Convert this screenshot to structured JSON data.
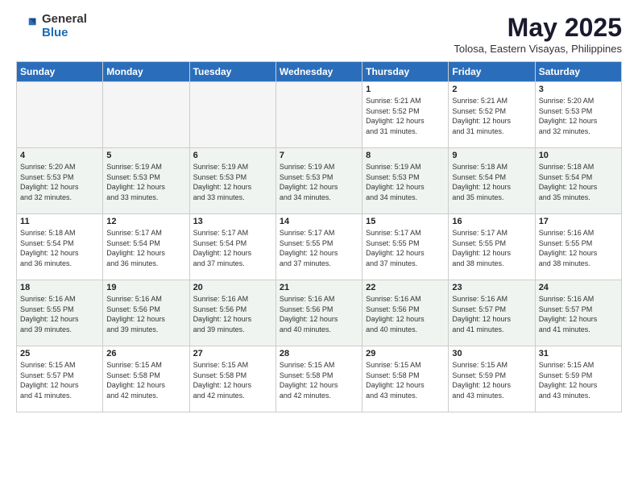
{
  "logo": {
    "general": "General",
    "blue": "Blue"
  },
  "title": "May 2025",
  "subtitle": "Tolosa, Eastern Visayas, Philippines",
  "headers": [
    "Sunday",
    "Monday",
    "Tuesday",
    "Wednesday",
    "Thursday",
    "Friday",
    "Saturday"
  ],
  "weeks": [
    {
      "shaded": false,
      "days": [
        {
          "num": "",
          "info": "",
          "empty": true
        },
        {
          "num": "",
          "info": "",
          "empty": true
        },
        {
          "num": "",
          "info": "",
          "empty": true
        },
        {
          "num": "",
          "info": "",
          "empty": true
        },
        {
          "num": "1",
          "info": "Sunrise: 5:21 AM\nSunset: 5:52 PM\nDaylight: 12 hours\nand 31 minutes."
        },
        {
          "num": "2",
          "info": "Sunrise: 5:21 AM\nSunset: 5:52 PM\nDaylight: 12 hours\nand 31 minutes."
        },
        {
          "num": "3",
          "info": "Sunrise: 5:20 AM\nSunset: 5:53 PM\nDaylight: 12 hours\nand 32 minutes."
        }
      ]
    },
    {
      "shaded": true,
      "days": [
        {
          "num": "4",
          "info": "Sunrise: 5:20 AM\nSunset: 5:53 PM\nDaylight: 12 hours\nand 32 minutes."
        },
        {
          "num": "5",
          "info": "Sunrise: 5:19 AM\nSunset: 5:53 PM\nDaylight: 12 hours\nand 33 minutes."
        },
        {
          "num": "6",
          "info": "Sunrise: 5:19 AM\nSunset: 5:53 PM\nDaylight: 12 hours\nand 33 minutes."
        },
        {
          "num": "7",
          "info": "Sunrise: 5:19 AM\nSunset: 5:53 PM\nDaylight: 12 hours\nand 34 minutes."
        },
        {
          "num": "8",
          "info": "Sunrise: 5:19 AM\nSunset: 5:53 PM\nDaylight: 12 hours\nand 34 minutes."
        },
        {
          "num": "9",
          "info": "Sunrise: 5:18 AM\nSunset: 5:54 PM\nDaylight: 12 hours\nand 35 minutes."
        },
        {
          "num": "10",
          "info": "Sunrise: 5:18 AM\nSunset: 5:54 PM\nDaylight: 12 hours\nand 35 minutes."
        }
      ]
    },
    {
      "shaded": false,
      "days": [
        {
          "num": "11",
          "info": "Sunrise: 5:18 AM\nSunset: 5:54 PM\nDaylight: 12 hours\nand 36 minutes."
        },
        {
          "num": "12",
          "info": "Sunrise: 5:17 AM\nSunset: 5:54 PM\nDaylight: 12 hours\nand 36 minutes."
        },
        {
          "num": "13",
          "info": "Sunrise: 5:17 AM\nSunset: 5:54 PM\nDaylight: 12 hours\nand 37 minutes."
        },
        {
          "num": "14",
          "info": "Sunrise: 5:17 AM\nSunset: 5:55 PM\nDaylight: 12 hours\nand 37 minutes."
        },
        {
          "num": "15",
          "info": "Sunrise: 5:17 AM\nSunset: 5:55 PM\nDaylight: 12 hours\nand 37 minutes."
        },
        {
          "num": "16",
          "info": "Sunrise: 5:17 AM\nSunset: 5:55 PM\nDaylight: 12 hours\nand 38 minutes."
        },
        {
          "num": "17",
          "info": "Sunrise: 5:16 AM\nSunset: 5:55 PM\nDaylight: 12 hours\nand 38 minutes."
        }
      ]
    },
    {
      "shaded": true,
      "days": [
        {
          "num": "18",
          "info": "Sunrise: 5:16 AM\nSunset: 5:55 PM\nDaylight: 12 hours\nand 39 minutes."
        },
        {
          "num": "19",
          "info": "Sunrise: 5:16 AM\nSunset: 5:56 PM\nDaylight: 12 hours\nand 39 minutes."
        },
        {
          "num": "20",
          "info": "Sunrise: 5:16 AM\nSunset: 5:56 PM\nDaylight: 12 hours\nand 39 minutes."
        },
        {
          "num": "21",
          "info": "Sunrise: 5:16 AM\nSunset: 5:56 PM\nDaylight: 12 hours\nand 40 minutes."
        },
        {
          "num": "22",
          "info": "Sunrise: 5:16 AM\nSunset: 5:56 PM\nDaylight: 12 hours\nand 40 minutes."
        },
        {
          "num": "23",
          "info": "Sunrise: 5:16 AM\nSunset: 5:57 PM\nDaylight: 12 hours\nand 41 minutes."
        },
        {
          "num": "24",
          "info": "Sunrise: 5:16 AM\nSunset: 5:57 PM\nDaylight: 12 hours\nand 41 minutes."
        }
      ]
    },
    {
      "shaded": false,
      "days": [
        {
          "num": "25",
          "info": "Sunrise: 5:15 AM\nSunset: 5:57 PM\nDaylight: 12 hours\nand 41 minutes."
        },
        {
          "num": "26",
          "info": "Sunrise: 5:15 AM\nSunset: 5:58 PM\nDaylight: 12 hours\nand 42 minutes."
        },
        {
          "num": "27",
          "info": "Sunrise: 5:15 AM\nSunset: 5:58 PM\nDaylight: 12 hours\nand 42 minutes."
        },
        {
          "num": "28",
          "info": "Sunrise: 5:15 AM\nSunset: 5:58 PM\nDaylight: 12 hours\nand 42 minutes."
        },
        {
          "num": "29",
          "info": "Sunrise: 5:15 AM\nSunset: 5:58 PM\nDaylight: 12 hours\nand 43 minutes."
        },
        {
          "num": "30",
          "info": "Sunrise: 5:15 AM\nSunset: 5:59 PM\nDaylight: 12 hours\nand 43 minutes."
        },
        {
          "num": "31",
          "info": "Sunrise: 5:15 AM\nSunset: 5:59 PM\nDaylight: 12 hours\nand 43 minutes."
        }
      ]
    }
  ]
}
